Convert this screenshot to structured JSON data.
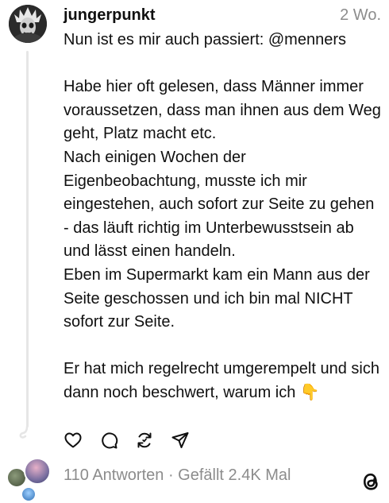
{
  "post": {
    "username": "jungerpunkt",
    "time": "2 Wo.",
    "text": "Nun ist es mir auch passiert: @menners\n\nHabe hier oft gelesen, dass Männer immer voraussetzen, dass man ihnen aus dem Weg geht, Platz macht etc.\nNach einigen Wochen der Eigenbeobachtung, musste ich mir eingestehen, auch sofort zur Seite zu gehen - das läuft richtig im Unterbewusstsein ab und lässt einen handeln.\nEben im Supermarkt kam ein Mann aus der Seite geschossen und ich bin mal NICHT sofort zur Seite.\n\nEr hat mich regelrecht umgerempelt und sich dann noch beschwert, warum ich 👇"
  },
  "actions": {
    "like_icon": "heart-icon",
    "reply_icon": "comment-icon",
    "repost_icon": "repost-icon",
    "share_icon": "send-icon"
  },
  "stats": {
    "replies_and_likes": "110 Antworten · Gefällt 2.4K Mal"
  },
  "brand": {
    "logo_icon": "threads-logo-icon"
  },
  "colors": {
    "text": "#101010",
    "secondary_text": "#8c8c8c",
    "thread_line": "#e6e6e6",
    "background": "#ffffff"
  }
}
